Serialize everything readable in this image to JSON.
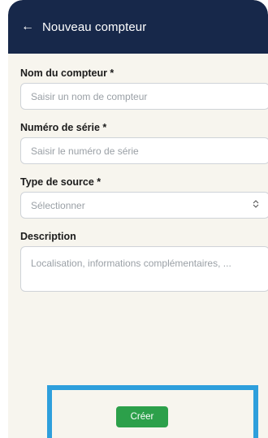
{
  "header": {
    "back_icon": "←",
    "title": "Nouveau compteur"
  },
  "form": {
    "name": {
      "label": "Nom du compteur *",
      "placeholder": "Saisir un nom de compteur"
    },
    "serial": {
      "label": "Numéro de série *",
      "placeholder": "Saisir le numéro de série"
    },
    "source_type": {
      "label": "Type de source *",
      "placeholder": "Sélectionner",
      "icon": "updown-chevron-icon"
    },
    "description": {
      "label": "Description",
      "placeholder": "Localisation, informations complémentaires, ..."
    }
  },
  "actions": {
    "create_label": "Créer"
  },
  "colors": {
    "header": "#17284a",
    "background": "#f7f5ee",
    "button": "#2ca04a",
    "highlight": "#2e9fdc"
  }
}
